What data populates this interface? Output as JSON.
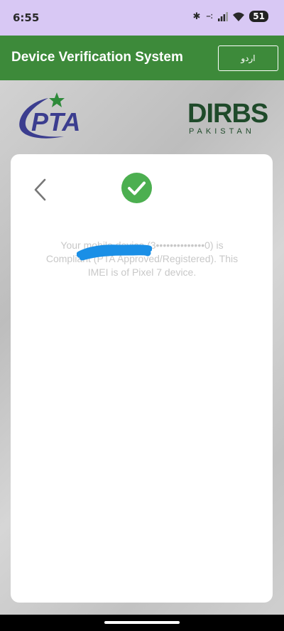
{
  "status_bar": {
    "time": "6:55",
    "icons": [
      "bluetooth-icon",
      "vibrate-icon",
      "signal-icon",
      "wifi-icon"
    ],
    "battery": "51"
  },
  "app_bar": {
    "title": "Device Verification System",
    "language_button": "اردو",
    "background_color": "#3d8a3a"
  },
  "logos": {
    "pta": "PTA",
    "dirbs": "DIRBS",
    "dirbs_sub": "PAKISTAN"
  },
  "result": {
    "status_icon": "check-circle-icon",
    "status_color": "#4caf50",
    "message": "Your mobile device (3••••••••••••••0) is Compliant (PTA Approved/Registered). This IMEI is of Pixel 7 device."
  }
}
